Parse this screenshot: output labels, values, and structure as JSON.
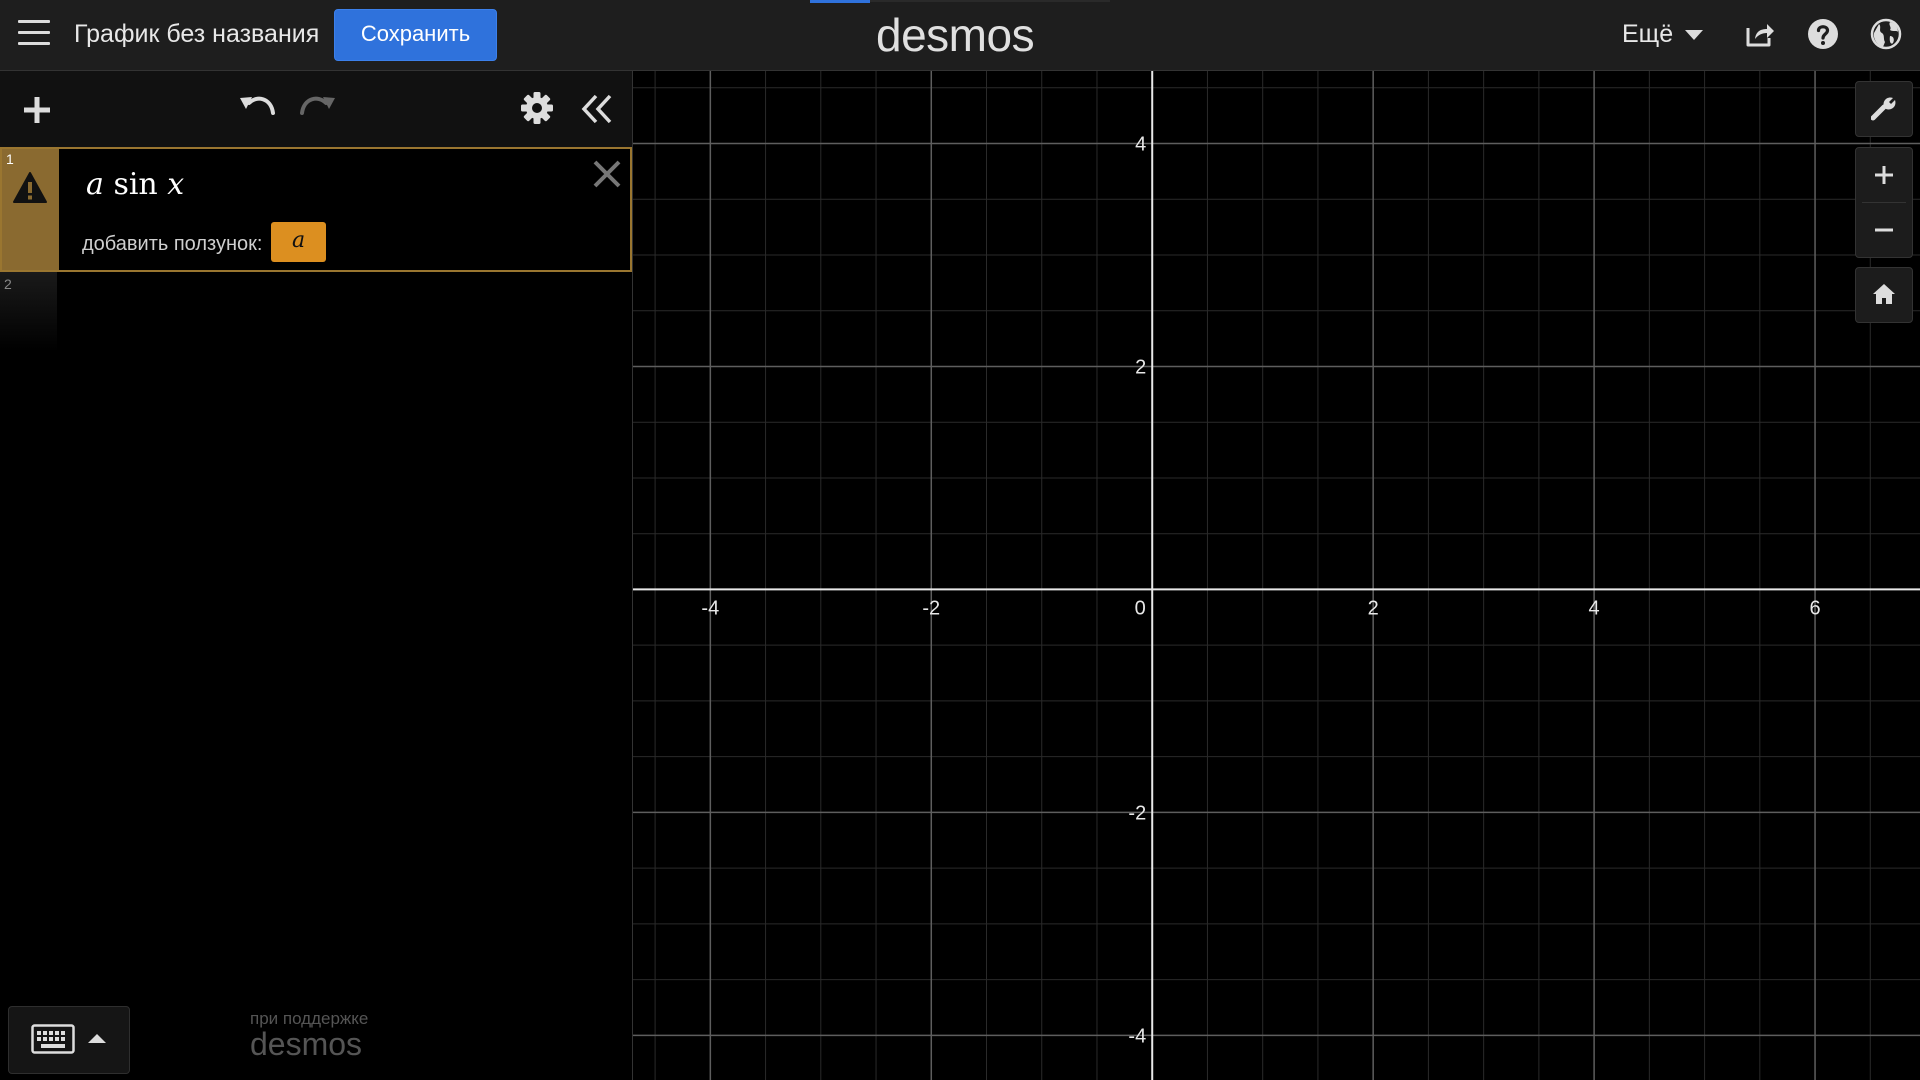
{
  "header": {
    "graph_title": "График без названия",
    "save_label": "Сохранить",
    "logo_text": "desmos",
    "more_label": "Ещё",
    "icons": [
      "menu-icon",
      "share-icon",
      "help-icon",
      "globe-icon"
    ]
  },
  "expression_panel": {
    "toolbar_icons": [
      "add-icon",
      "undo-icon",
      "redo-icon",
      "settings-icon",
      "collapse-icon"
    ],
    "expressions": [
      {
        "index": "1",
        "latex_display": "a sin x",
        "formula_var1": "a",
        "formula_fn": "sin",
        "formula_var2": "x",
        "warning": true,
        "add_slider_label": "добавить ползунок:",
        "slider_variable": "a",
        "color": "#9a7630"
      },
      {
        "index": "2",
        "latex_display": ""
      }
    ],
    "powered_by_line1": "при поддержке",
    "powered_by_line2": "desmos"
  },
  "graph": {
    "x_tick_labels": [
      "-4",
      "-2",
      "0",
      "2",
      "4",
      "6"
    ],
    "y_tick_labels": [
      "4",
      "2",
      "-2",
      "-4"
    ],
    "x_range": [
      -4.7,
      6.95
    ],
    "y_range": [
      -4.4,
      4.65
    ],
    "grid": true,
    "controls": [
      "wrench-icon",
      "zoom-in-icon",
      "zoom-out-icon",
      "home-icon"
    ]
  },
  "colors": {
    "accent": "#2f72dc",
    "expression_border": "#9a7630",
    "slider_button": "#dc8f20",
    "background": "#000000",
    "header": "#1e1e1e"
  }
}
